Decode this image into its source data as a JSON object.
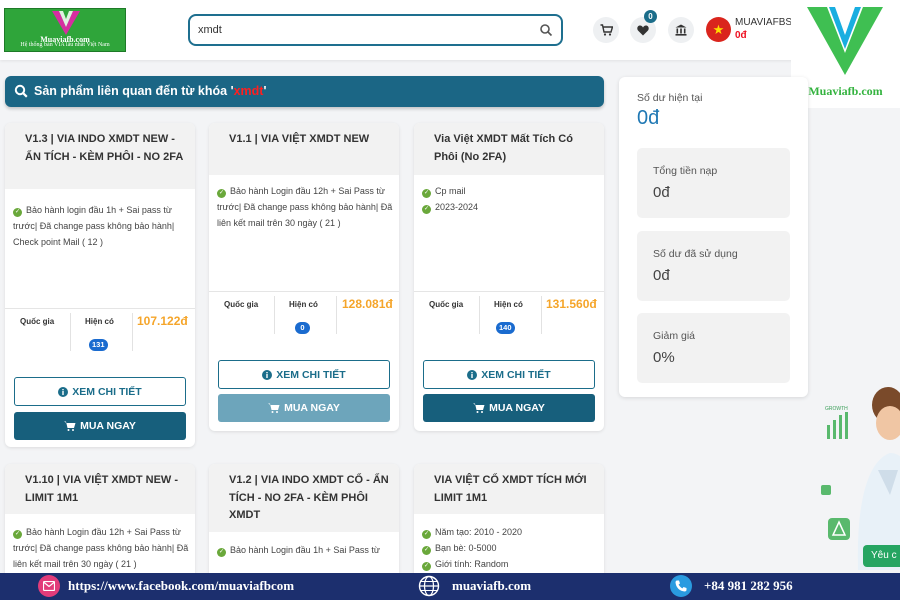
{
  "header": {
    "logo": {
      "site": "Muaviafb.com",
      "tagline": "Hệ thống bán VIA lâu nhất Việt Nam"
    },
    "search": {
      "value": "xmdt"
    },
    "wishlist_count": "0",
    "user": {
      "name": "MUAVIAFBSH",
      "balance": "0đ"
    },
    "brand": {
      "text": "Muaviafb.com"
    }
  },
  "banner": {
    "prefix": "Sản phẩm liên quan đến từ khóa '",
    "keyword": "xmdt",
    "suffix": "'"
  },
  "labels": {
    "country": "Quốc gia",
    "available": "Hiện có",
    "detail": "XEM CHI TIẾT",
    "buy": "MUA NGAY"
  },
  "products": [
    {
      "title": "V1.3 | VIA INDO XMDT NEW - ẨN TÍCH - KÈM PHÔI - NO 2FA",
      "features": [
        "Bảo hành login đầu 1h + Sai pass từ trước| Đã change pass không bảo hành| Check point Mail ( 12 )"
      ],
      "stock": "131",
      "price": "107.122đ"
    },
    {
      "title": "V1.1 | VIA VIỆT XMDT NEW",
      "features": [
        "Bảo hành Login đầu 12h + Sai Pass từ trước| Đã change pass không bảo hành| Đã liên kết mail trên 30 ngày ( 21 )"
      ],
      "stock": "0",
      "price": "128.081đ"
    },
    {
      "title": "Via Việt XMDT Mất Tích Có Phôi (No 2FA)",
      "features": [
        "Cp mail",
        "2023-2024"
      ],
      "stock": "140",
      "price": "131.560đ"
    },
    {
      "title": "V1.10 | VIA VIỆT XMDT NEW - LIMIT 1M1",
      "features": [
        "Bảo hành Login đầu 12h + Sai Pass từ trước| Đã change pass không bảo hành| Đã liên kết mail trên 30 ngày ( 21 )"
      ]
    },
    {
      "title": "V1.2 | VIA INDO XMDT CỔ - ẨN TÍCH - NO 2FA - KÈM PHÔI XMDT",
      "features": [
        "Bảo hành Login đầu 1h + Sai Pass từ"
      ]
    },
    {
      "title": "VIA VIỆT CỔ XMDT TÍCH MỚI LIMIT 1M1",
      "features": [
        "Năm tạo: 2010 - 2020",
        "Bạn bè: 0-5000",
        "Giới tính: Random"
      ]
    }
  ],
  "balance_panel": {
    "current_label": "Số dư hiện tại",
    "current_value": "0đ",
    "stats": [
      {
        "label": "Tổng tiền nạp",
        "value": "0đ"
      },
      {
        "label": "Số dư đã sử dụng",
        "value": "0đ"
      },
      {
        "label": "Giảm giá",
        "value": "0%"
      }
    ]
  },
  "assistant": {
    "chip": "Yêu c",
    "growth": "GROWTH"
  },
  "footer": {
    "facebook": "https://www.facebook.com/muaviafbcom",
    "site": "muaviafb.com",
    "phone": "+84 981 282 956"
  },
  "colors": {
    "primary": "#1b6685",
    "accent": "#f5a52a",
    "brand_green": "#34b33f",
    "footer_bg": "#1c2f6e"
  }
}
